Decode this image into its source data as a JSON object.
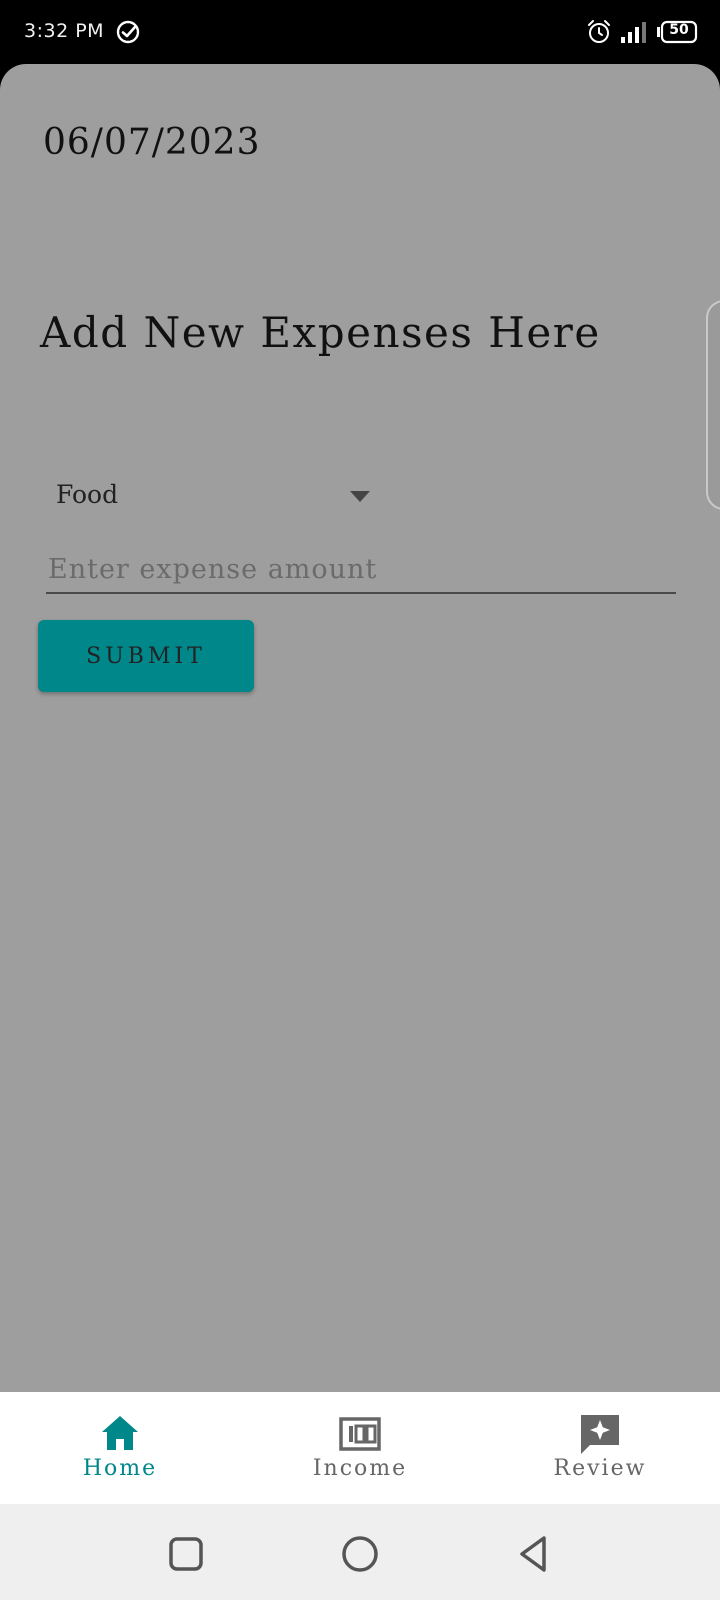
{
  "status_bar": {
    "time": "3:32 PM",
    "battery": "50",
    "icons": [
      "check-circle-icon",
      "alarm-icon",
      "signal-icon",
      "battery-icon"
    ]
  },
  "main": {
    "date": "06/07/2023",
    "heading": "Add New Expenses Here",
    "category_select": {
      "selected": "Food"
    },
    "amount_field": {
      "placeholder": "Enter expense amount",
      "value": ""
    },
    "submit_label": "SUBMIT"
  },
  "bottom_nav": {
    "items": [
      {
        "label": "Home",
        "icon": "home-icon",
        "active": true
      },
      {
        "label": "Income",
        "icon": "money-icon",
        "active": false
      },
      {
        "label": "Review",
        "icon": "review-icon",
        "active": false
      }
    ]
  },
  "system_nav": {
    "buttons": [
      "recents-button",
      "home-button",
      "back-button"
    ]
  },
  "colors": {
    "accent": "#00878A",
    "overlay_background": "#9E9E9E",
    "inactive_nav": "#666666"
  }
}
